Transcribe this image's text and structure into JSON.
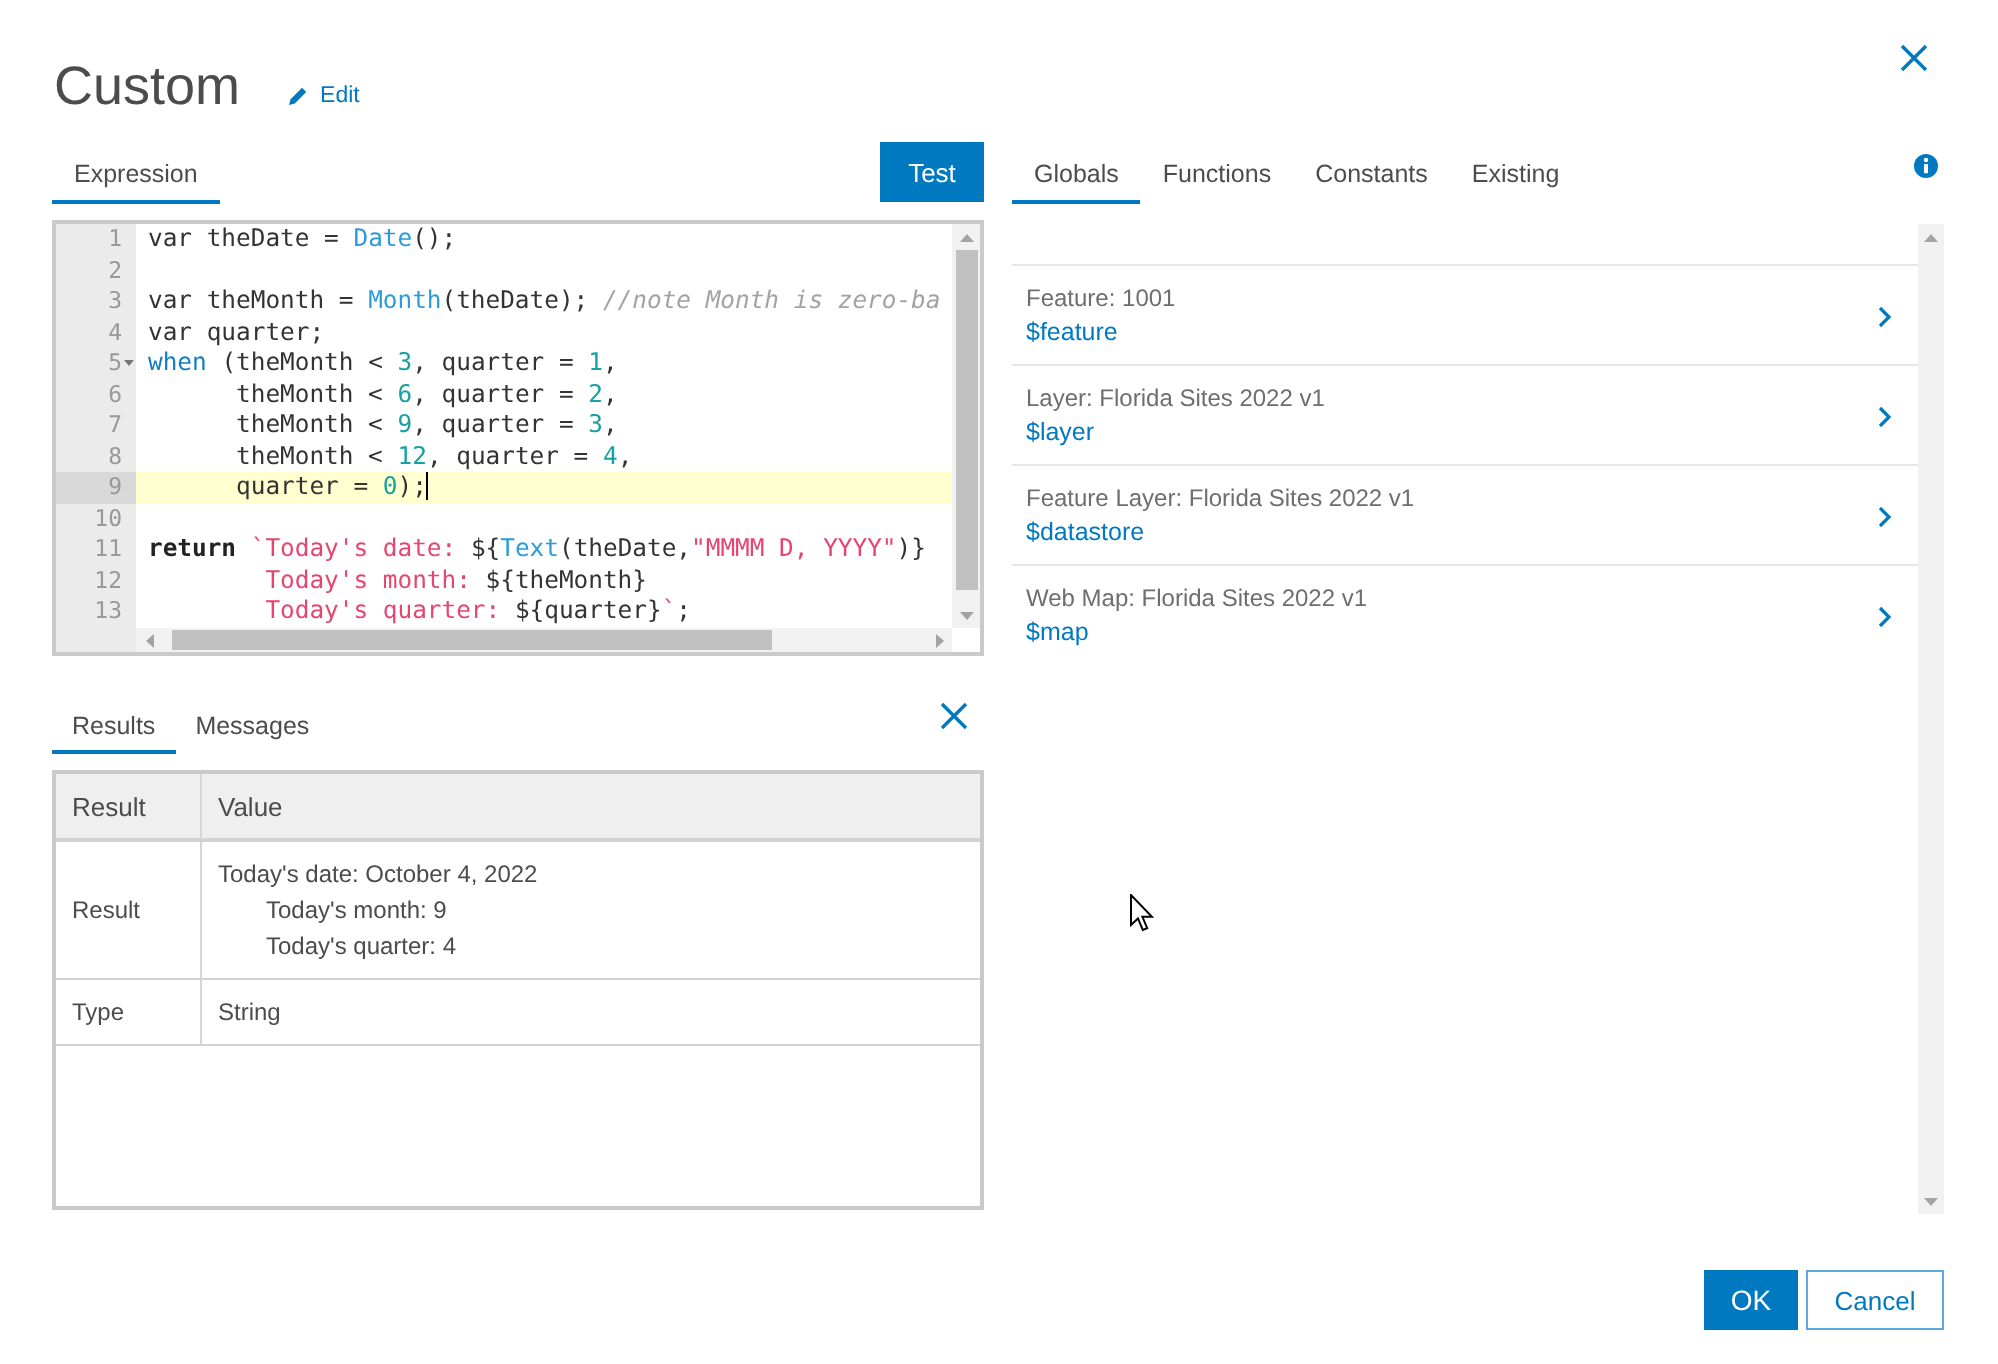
{
  "dialog": {
    "title": "Custom",
    "edit_link": "Edit"
  },
  "expression_panel": {
    "tabs": [
      {
        "label": "Expression",
        "selected": true
      }
    ],
    "test_button": "Test",
    "editor": {
      "lines": [
        {
          "number": "1",
          "active": false,
          "foldable": false,
          "tokens": [
            {
              "kind": "plain",
              "text": "var theDate = "
            },
            {
              "kind": "function",
              "text": "Date"
            },
            {
              "kind": "plain",
              "text": "();"
            }
          ]
        },
        {
          "number": "2",
          "active": false,
          "foldable": false
        },
        {
          "number": "3",
          "active": false,
          "foldable": false,
          "tokens": [
            {
              "kind": "plain",
              "text": "var theMonth = "
            },
            {
              "kind": "function",
              "text": "Month"
            },
            {
              "kind": "plain",
              "text": "(theDate); "
            },
            {
              "kind": "comment",
              "text": "//note Month is zero-ba"
            }
          ]
        },
        {
          "number": "4",
          "active": false,
          "foldable": false,
          "tokens": [
            {
              "kind": "plain",
              "text": "var quarter;"
            }
          ]
        },
        {
          "number": "5",
          "active": false,
          "foldable": true,
          "tokens": [
            {
              "kind": "keyword",
              "text": "when"
            },
            {
              "kind": "plain",
              "text": " (theMonth < "
            },
            {
              "kind": "number",
              "text": "3"
            },
            {
              "kind": "plain",
              "text": ", quarter = "
            },
            {
              "kind": "number",
              "text": "1"
            },
            {
              "kind": "plain",
              "text": ","
            }
          ]
        },
        {
          "number": "6",
          "active": false,
          "foldable": false,
          "tokens": [
            {
              "kind": "plain",
              "text": "      theMonth < "
            },
            {
              "kind": "number",
              "text": "6"
            },
            {
              "kind": "plain",
              "text": ", quarter = "
            },
            {
              "kind": "number",
              "text": "2"
            },
            {
              "kind": "plain",
              "text": ","
            }
          ]
        },
        {
          "number": "7",
          "active": false,
          "foldable": false,
          "tokens": [
            {
              "kind": "plain",
              "text": "      theMonth < "
            },
            {
              "kind": "number",
              "text": "9"
            },
            {
              "kind": "plain",
              "text": ", quarter = "
            },
            {
              "kind": "number",
              "text": "3"
            },
            {
              "kind": "plain",
              "text": ","
            }
          ]
        },
        {
          "number": "8",
          "active": false,
          "foldable": false,
          "tokens": [
            {
              "kind": "plain",
              "text": "      theMonth < "
            },
            {
              "kind": "number",
              "text": "12"
            },
            {
              "kind": "plain",
              "text": ", quarter = "
            },
            {
              "kind": "number",
              "text": "4"
            },
            {
              "kind": "plain",
              "text": ","
            }
          ]
        },
        {
          "number": "9",
          "active": true,
          "foldable": false,
          "tokens": [
            {
              "kind": "plain",
              "text": "      quarter = "
            },
            {
              "kind": "number",
              "text": "0"
            },
            {
              "kind": "plain",
              "text": ");"
            }
          ]
        },
        {
          "number": "10",
          "active": false,
          "foldable": false
        },
        {
          "number": "11",
          "active": false,
          "foldable": false,
          "tokens": [
            {
              "kind": "return",
              "text": "return"
            },
            {
              "kind": "string",
              "text": " `Today's date: "
            },
            {
              "kind": "plain",
              "text": "${"
            },
            {
              "kind": "function",
              "text": "Text"
            },
            {
              "kind": "plain",
              "text": "(theDate,"
            },
            {
              "kind": "string",
              "text": "\"MMMM D, YYYY\""
            },
            {
              "kind": "plain",
              "text": ")}"
            }
          ]
        },
        {
          "number": "12",
          "active": false,
          "foldable": false,
          "tokens": [
            {
              "kind": "string",
              "text": "        Today's month: "
            },
            {
              "kind": "plain",
              "text": "${theMonth}"
            }
          ]
        },
        {
          "number": "13",
          "active": false,
          "foldable": false,
          "tokens": [
            {
              "kind": "string",
              "text": "        Today's quarter: "
            },
            {
              "kind": "plain",
              "text": "${quarter}"
            },
            {
              "kind": "string",
              "text": "`"
            },
            {
              "kind": "plain",
              "text": ";"
            }
          ]
        }
      ]
    }
  },
  "results_panel": {
    "tabs": [
      {
        "label": "Results",
        "selected": true
      },
      {
        "label": "Messages",
        "selected": false
      }
    ],
    "table": {
      "columns": [
        "Result",
        "Value"
      ],
      "rows": [
        {
          "label": "Result",
          "value": "Today's date: October 4, 2022\n\tToday's month: 9\n\tToday's quarter: 4"
        },
        {
          "label": "Type",
          "value": "String"
        }
      ]
    }
  },
  "globals_panel": {
    "tabs": [
      {
        "label": "Globals",
        "selected": true
      },
      {
        "label": "Functions",
        "selected": false
      },
      {
        "label": "Constants",
        "selected": false
      },
      {
        "label": "Existing",
        "selected": false
      }
    ],
    "items": [
      {
        "label": "Feature: 1001",
        "variable": "$feature"
      },
      {
        "label": "Layer: Florida Sites 2022 v1",
        "variable": "$layer"
      },
      {
        "label": "Feature Layer: Florida Sites 2022 v1",
        "variable": "$datastore"
      },
      {
        "label": "Web Map: Florida Sites 2022 v1",
        "variable": "$map"
      }
    ]
  },
  "buttons": [
    {
      "kind": "primary",
      "label": "OK"
    },
    {
      "kind": "secondary",
      "label": "Cancel"
    }
  ]
}
